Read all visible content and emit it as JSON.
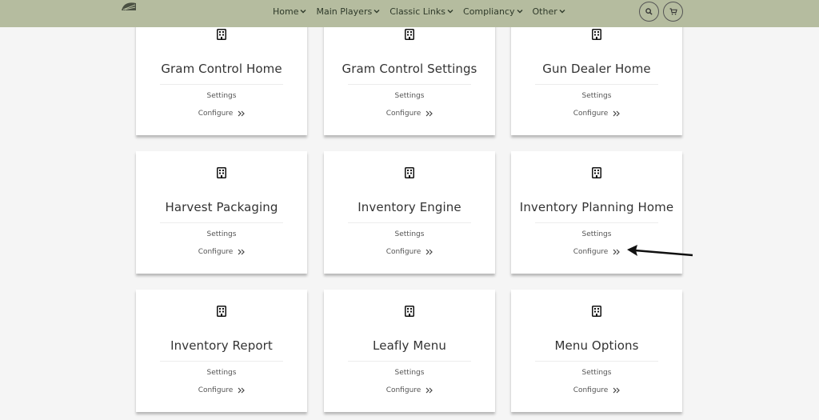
{
  "nav": {
    "items": [
      {
        "label": "Home"
      },
      {
        "label": "Main Players"
      },
      {
        "label": "Classic Links"
      },
      {
        "label": "Compliancy"
      },
      {
        "label": "Other"
      }
    ],
    "search_icon": "search-icon",
    "cart_icon": "cart-icon",
    "colors": {
      "bar": "#b5bc9f",
      "text": "#2f3a2a"
    }
  },
  "cards": [
    {
      "title": "Gram Control Home",
      "settings": "Settings",
      "configure": "Configure"
    },
    {
      "title": "Gram Control Settings",
      "settings": "Settings",
      "configure": "Configure"
    },
    {
      "title": "Gun Dealer Home",
      "settings": "Settings",
      "configure": "Configure"
    },
    {
      "title": "Harvest Packaging",
      "settings": "Settings",
      "configure": "Configure"
    },
    {
      "title": "Inventory Engine",
      "settings": "Settings",
      "configure": "Configure"
    },
    {
      "title": "Inventory Planning Home",
      "settings": "Settings",
      "configure": "Configure"
    },
    {
      "title": "Inventory Report",
      "settings": "Settings",
      "configure": "Configure"
    },
    {
      "title": "Leafly Menu",
      "settings": "Settings",
      "configure": "Configure"
    },
    {
      "title": "Menu Options",
      "settings": "Settings",
      "configure": "Configure"
    }
  ],
  "card_icon": "building-icon",
  "annotation_icon": "arrow-pointer-icon"
}
